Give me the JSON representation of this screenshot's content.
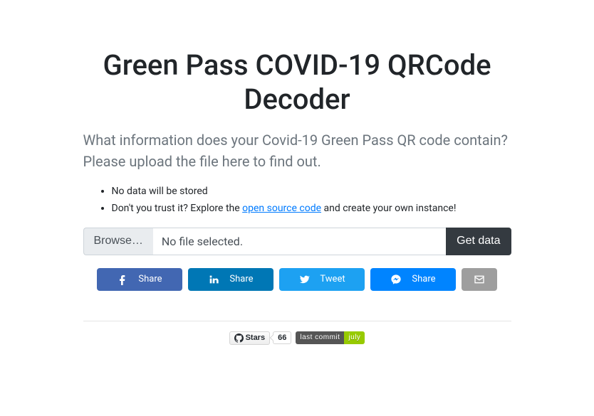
{
  "title": "Green Pass COVID-19 QRCode Decoder",
  "subtitle": "What information does your Covid-19 Green Pass QR code contain? Please upload the file here to find out.",
  "bullets": {
    "item0": "No data will be stored",
    "item1_prefix": "Don't you trust it? Explore the ",
    "item1_link": "open source code",
    "item1_suffix": " and create your own instance!"
  },
  "upload": {
    "browse_label": "Browse…",
    "file_status": "No file selected.",
    "submit_label": "Get data"
  },
  "share": {
    "facebook": "Share",
    "linkedin": "Share",
    "twitter": "Tweet",
    "messenger": "Share"
  },
  "badges": {
    "gh_label": "Stars",
    "gh_count": "66",
    "shield_label": "last commit",
    "shield_value": "july"
  }
}
